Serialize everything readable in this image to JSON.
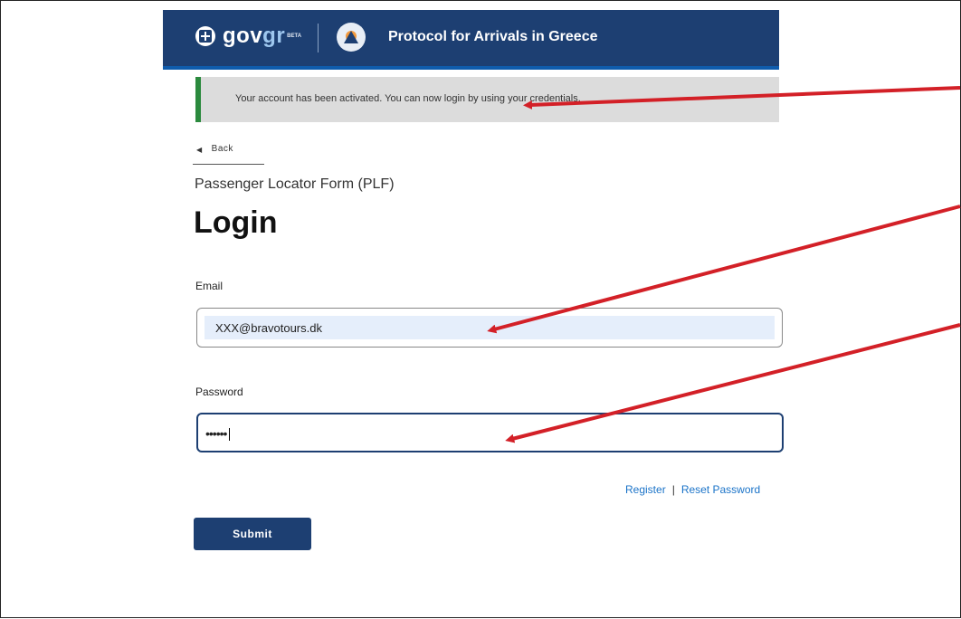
{
  "header": {
    "brand_prefix": "gov",
    "brand_suffix": "gr",
    "beta_label": "BETA",
    "site_title": "Protocol for Arrivals in Greece"
  },
  "alert": {
    "message": "Your account has been activated. You can now login by using your credentials."
  },
  "nav": {
    "back_label": "Back"
  },
  "page": {
    "subtitle": "Passenger Locator Form (PLF)",
    "title": "Login"
  },
  "form": {
    "email_label": "Email",
    "email_value": "XXX@bravotours.dk",
    "password_label": "Password",
    "password_value": "••••••",
    "submit_label": "Submit"
  },
  "links": {
    "register": "Register",
    "separator": "|",
    "reset_password": "Reset Password"
  },
  "icons": {
    "emblem": "greek-emblem-icon",
    "civil_protection": "civil-protection-icon",
    "back": "chevron-left-icon"
  },
  "colors": {
    "header_bg": "#1d3f72",
    "alert_bg": "#dcdcdc",
    "alert_accent": "#2b8a3e",
    "link": "#1a73c8",
    "annotation_arrow": "#d32027"
  }
}
